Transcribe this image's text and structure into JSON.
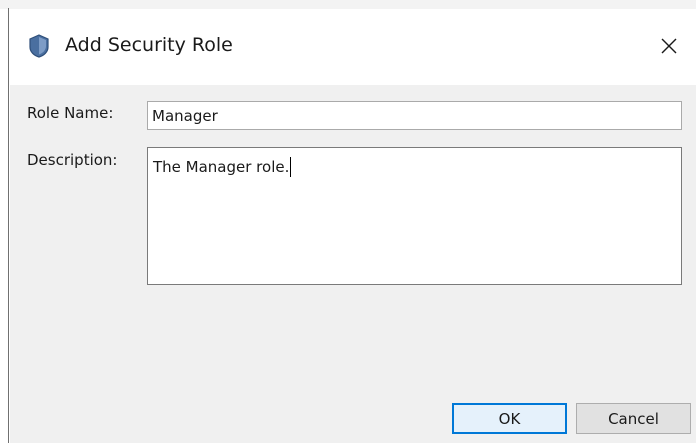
{
  "dialog": {
    "title": "Add Security Role",
    "title_icon": "shield-icon",
    "close_icon": "close-icon"
  },
  "form": {
    "role_name_label": "Role Name:",
    "role_name_value": "Manager",
    "description_label": "Description:",
    "description_value": "The Manager role."
  },
  "buttons": {
    "ok_label": "OK",
    "cancel_label": "Cancel"
  },
  "colors": {
    "content_background": "#f0f0f0",
    "default_button_border": "#0078d7",
    "icon_fill": "#4a6fa0"
  }
}
